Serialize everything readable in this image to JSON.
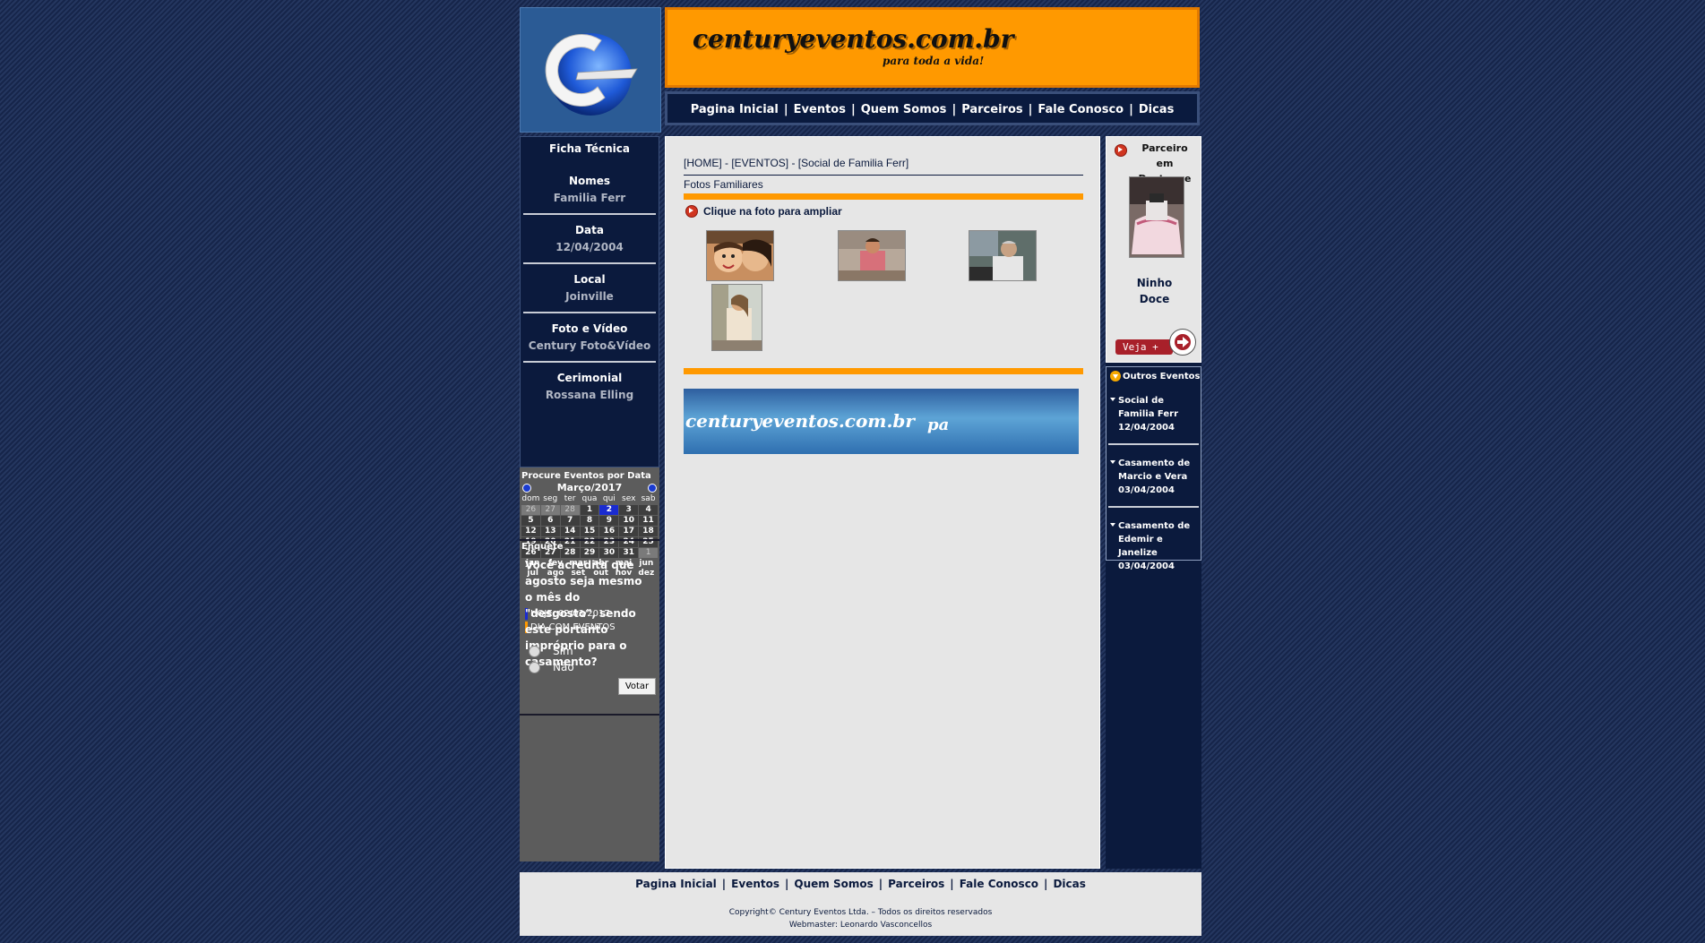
{
  "brand": {
    "title": "centuryeventos.com.br",
    "subtitle": "para toda a vida!"
  },
  "nav": [
    {
      "label": "Pagina Inicial"
    },
    {
      "label": "Eventos"
    },
    {
      "label": "Quem Somos"
    },
    {
      "label": "Parceiros"
    },
    {
      "label": "Fale Conosco"
    },
    {
      "label": "Dicas"
    }
  ],
  "ficha": {
    "title": "Ficha Técnica",
    "items": [
      {
        "label": "Nomes",
        "value": "Familia Ferr"
      },
      {
        "label": "Data",
        "value": "12/04/2004"
      },
      {
        "label": "Local",
        "value": "Joinville"
      },
      {
        "label": "Foto e Vídeo",
        "value": "Century Foto&Vídeo"
      },
      {
        "label": "Cerimonial",
        "value": "Rossana Elling"
      }
    ]
  },
  "calendar": {
    "title": "Procure Eventos por Data",
    "month": "Março/2017",
    "weekdays": [
      "dom",
      "seg",
      "ter",
      "qua",
      "qui",
      "sex",
      "sab"
    ],
    "days": [
      "26",
      "27",
      "28",
      "1",
      "2",
      "3",
      "4",
      "5",
      "6",
      "7",
      "8",
      "9",
      "10",
      "11",
      "12",
      "13",
      "14",
      "15",
      "16",
      "17",
      "18",
      "19",
      "20",
      "21",
      "22",
      "23",
      "24",
      "25",
      "26",
      "27",
      "28",
      "29",
      "30",
      "31",
      "1"
    ],
    "months_row1": [
      "jan",
      "fev",
      "mar",
      "abr",
      "mai",
      "jun"
    ],
    "months_row2": [
      "jul",
      "ago",
      "set",
      "out",
      "nov",
      "dez"
    ],
    "legend_today": "HOJE, 02/03/2017",
    "legend_events": "DIA COM EVENTOS",
    "today_color": "#1a2bd0",
    "event_color": "#ff9900"
  },
  "enquete": {
    "title": "Enquete",
    "question": "Você acredita que agosto seja mesmo o mês do \"desgosto\", sendo este portanto impróprio para o casamento?",
    "options": [
      "Sim",
      "Não"
    ],
    "button": "Votar"
  },
  "main": {
    "breadcrumb": "[HOME] - [EVENTOS] - [Social de Familia Ferr]",
    "section_title": "Fotos Familiares",
    "hint": "Clique na foto para ampliar",
    "banner_text": "centuryeventos.com.br",
    "banner_tail": "pa"
  },
  "partner": {
    "title": "Parceiro em Destaque",
    "name_line1": "Ninho",
    "name_line2": "Doce",
    "button": "Veja +"
  },
  "outros": {
    "title": "Outros Eventos",
    "events": [
      {
        "line1": "Social de",
        "line2": "Familia Ferr",
        "date": "12/04/2004"
      },
      {
        "line1": "Casamento de",
        "line2": "Marcio e Vera",
        "date": "03/04/2004"
      },
      {
        "line1": "Casamento de",
        "line2": "Edemir e Janelize",
        "date": "03/04/2004"
      }
    ]
  },
  "footer": {
    "copyright": "Copyright© Century Eventos Ltda. – Todos os direitos reservados",
    "webmaster": "Webmaster: Leonardo Vasconcellos"
  },
  "colors": {
    "accent": "#ff9900",
    "navy": "#0b1a3d"
  }
}
